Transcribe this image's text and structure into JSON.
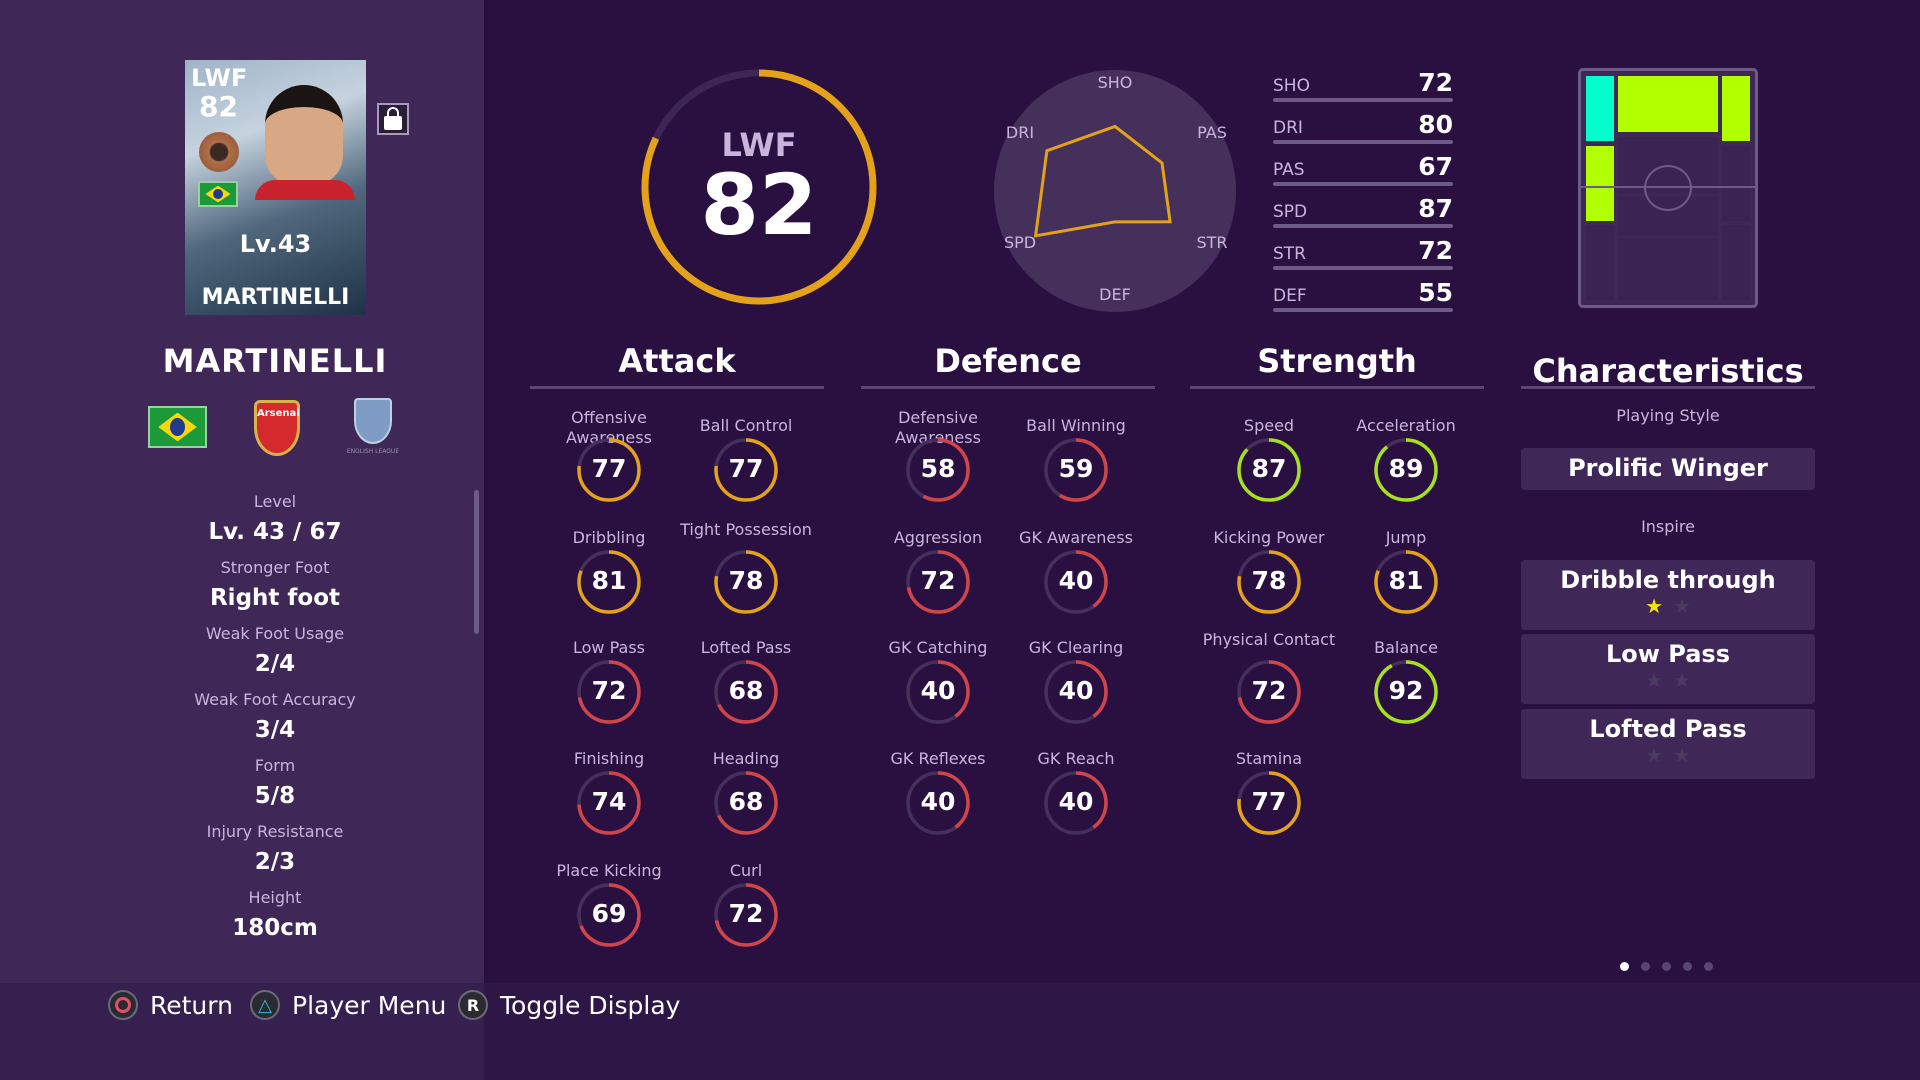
{
  "card": {
    "position": "LWF",
    "overall": "82",
    "level": "Lv.43",
    "name": "MARTINELLI"
  },
  "player_name": "MARTINELLI",
  "club_crest_text": "Arsenal",
  "league_text": "ENGLISH LEAGUE",
  "info": [
    {
      "label": "Level",
      "value": "Lv. 43 / 67"
    },
    {
      "label": "Stronger Foot",
      "value": "Right foot"
    },
    {
      "label": "Weak Foot Usage",
      "value": "2/4"
    },
    {
      "label": "Weak Foot Accuracy",
      "value": "3/4"
    },
    {
      "label": "Form",
      "value": "5/8"
    },
    {
      "label": "Injury Resistance",
      "value": "2/3"
    },
    {
      "label": "Height",
      "value": "180cm"
    }
  ],
  "overall": {
    "position": "LWF",
    "rating": 82
  },
  "radar": {
    "labels": [
      "SHO",
      "PAS",
      "STR",
      "DEF",
      "SPD",
      "DRI"
    ],
    "values": [
      72,
      67,
      72,
      55,
      87,
      80
    ]
  },
  "summary_stats": [
    {
      "key": "SHO",
      "value": "72"
    },
    {
      "key": "DRI",
      "value": "80"
    },
    {
      "key": "PAS",
      "value": "67"
    },
    {
      "key": "SPD",
      "value": "87"
    },
    {
      "key": "STR",
      "value": "72"
    },
    {
      "key": "DEF",
      "value": "55"
    }
  ],
  "colors": {
    "gauge_low": "#d0454a",
    "gauge_mid": "#e3a21a",
    "gauge_high": "#a6e01e",
    "track": "#45305c",
    "accent_cyan": "#00ffcc",
    "accent_lime": "#b2ff00",
    "star": "#f5e30c"
  },
  "sections": [
    {
      "title": "Attack",
      "stats": [
        {
          "label": "Offensive Awareness",
          "value": 77
        },
        {
          "label": "Ball Control",
          "value": 77
        },
        {
          "label": "Dribbling",
          "value": 81
        },
        {
          "label": "Tight Possession",
          "value": 78
        },
        {
          "label": "Low Pass",
          "value": 72
        },
        {
          "label": "Lofted Pass",
          "value": 68
        },
        {
          "label": "Finishing",
          "value": 74
        },
        {
          "label": "Heading",
          "value": 68
        },
        {
          "label": "Place Kicking",
          "value": 69
        },
        {
          "label": "Curl",
          "value": 72
        }
      ]
    },
    {
      "title": "Defence",
      "stats": [
        {
          "label": "Defensive Awareness",
          "value": 58
        },
        {
          "label": "Ball Winning",
          "value": 59
        },
        {
          "label": "Aggression",
          "value": 72
        },
        {
          "label": "GK Awareness",
          "value": 40
        },
        {
          "label": "GK Catching",
          "value": 40
        },
        {
          "label": "GK Clearing",
          "value": 40
        },
        {
          "label": "GK Reflexes",
          "value": 40
        },
        {
          "label": "GK Reach",
          "value": 40
        }
      ]
    },
    {
      "title": "Strength",
      "stats": [
        {
          "label": "Speed",
          "value": 87
        },
        {
          "label": "Acceleration",
          "value": 89
        },
        {
          "label": "Kicking Power",
          "value": 78
        },
        {
          "label": "Jump",
          "value": 81
        },
        {
          "label": "Physical Contact",
          "value": 72
        },
        {
          "label": "Balance",
          "value": 92
        },
        {
          "label": "Stamina",
          "value": 77
        }
      ]
    }
  ],
  "characteristics": {
    "title": "Characteristics",
    "playing_style_label": "Playing Style",
    "playing_style": "Prolific Winger",
    "inspire_label": "Inspire",
    "inspire": [
      {
        "name": "Dribble through",
        "stars": 1,
        "max": 2
      },
      {
        "name": "Low Pass",
        "stars": 0,
        "max": 2
      },
      {
        "name": "Lofted Pass",
        "stars": 0,
        "max": 2
      }
    ]
  },
  "pagination": {
    "current": 1,
    "total": 5
  },
  "footer": [
    {
      "icon": "circle-button-icon",
      "label": "Return"
    },
    {
      "icon": "triangle-button-icon",
      "label": "Player Menu"
    },
    {
      "icon": "r-button-icon",
      "glyph": "R",
      "label": "Toggle Display"
    }
  ]
}
